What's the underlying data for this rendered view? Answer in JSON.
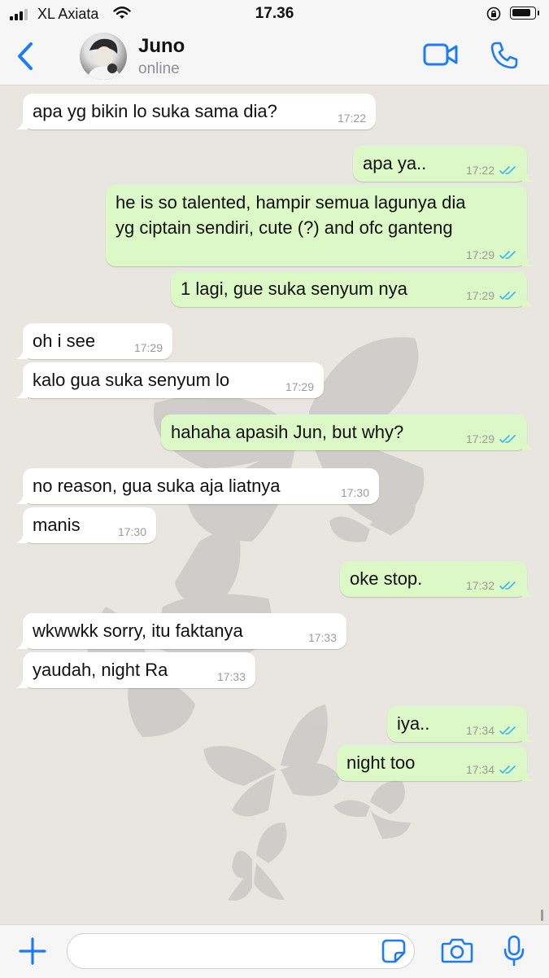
{
  "status_bar": {
    "carrier": "XL Axiata",
    "time": "17.36",
    "battery_level": 0.75
  },
  "header": {
    "back_icon": "chevron-left-icon",
    "contact_name": "Juno",
    "presence": "online",
    "video_icon": "video-camera-icon",
    "call_icon": "phone-icon"
  },
  "colors": {
    "accent": "#1c7cf4",
    "outgoing_bubble": "#dcf8c6",
    "incoming_bubble": "#ffffff",
    "read_ticks": "#34b7f1"
  },
  "messages": [
    {
      "dir": "in",
      "lines": [
        "apa yg bikin lo suka sama dia?"
      ],
      "time": "17:22"
    },
    {
      "dir": "out",
      "lines": [
        "apa ya.."
      ],
      "time": "17:22",
      "read": true
    },
    {
      "dir": "out",
      "lines": [
        "he is so talented, hampir semua lagunya dia",
        "yg ciptain sendiri, cute (?) and ofc ganteng"
      ],
      "time": "17:29",
      "read": true
    },
    {
      "dir": "out",
      "lines": [
        "1 lagi, gue suka senyum nya"
      ],
      "time": "17:29",
      "read": true
    },
    {
      "dir": "in",
      "lines": [
        "oh i see"
      ],
      "time": "17:29"
    },
    {
      "dir": "in",
      "lines": [
        "kalo gua suka senyum lo"
      ],
      "time": "17:29"
    },
    {
      "dir": "out",
      "lines": [
        "hahaha apasih Jun, but why?"
      ],
      "time": "17:29",
      "read": true
    },
    {
      "dir": "in",
      "lines": [
        "no reason, gua suka aja liatnya"
      ],
      "time": "17:30"
    },
    {
      "dir": "in",
      "lines": [
        "manis"
      ],
      "time": "17:30"
    },
    {
      "dir": "out",
      "lines": [
        "oke stop."
      ],
      "time": "17:32",
      "read": true
    },
    {
      "dir": "in",
      "lines": [
        "wkwwkk sorry, itu faktanya"
      ],
      "time": "17:33"
    },
    {
      "dir": "in",
      "lines": [
        "yaudah, night Ra"
      ],
      "time": "17:33"
    },
    {
      "dir": "out",
      "lines": [
        "iya.."
      ],
      "time": "17:34",
      "read": true
    },
    {
      "dir": "out",
      "lines": [
        "night too"
      ],
      "time": "17:34",
      "read": true
    }
  ],
  "composer": {
    "plus_icon": "plus-icon",
    "input_value": "",
    "sticker_icon": "sticker-icon",
    "camera_icon": "camera-icon",
    "mic_icon": "microphone-icon"
  }
}
